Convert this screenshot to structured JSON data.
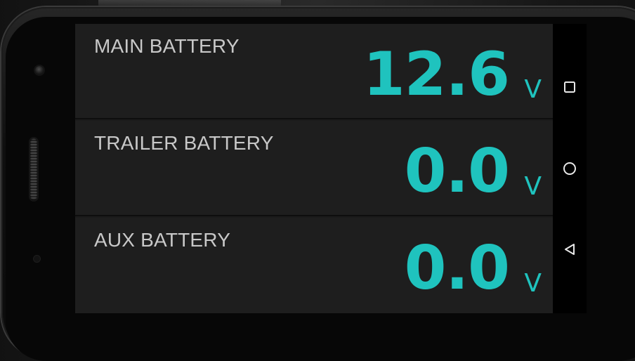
{
  "gauges": [
    {
      "label": "MAIN BATTERY",
      "value": "12.6",
      "unit": "V"
    },
    {
      "label": "TRAILER BATTERY",
      "value": "0.0",
      "unit": "V"
    },
    {
      "label": "AUX BATTERY",
      "value": "0.0",
      "unit": "V"
    }
  ],
  "navigation": {
    "buttons": [
      {
        "icon": "recents-square-icon"
      },
      {
        "icon": "home-circle-icon"
      },
      {
        "icon": "back-triangle-icon"
      }
    ]
  },
  "colors": {
    "accent": "#1fc3be",
    "label": "#c8c8c8",
    "panel": "#1e1e1e",
    "navbar": "#000000"
  }
}
